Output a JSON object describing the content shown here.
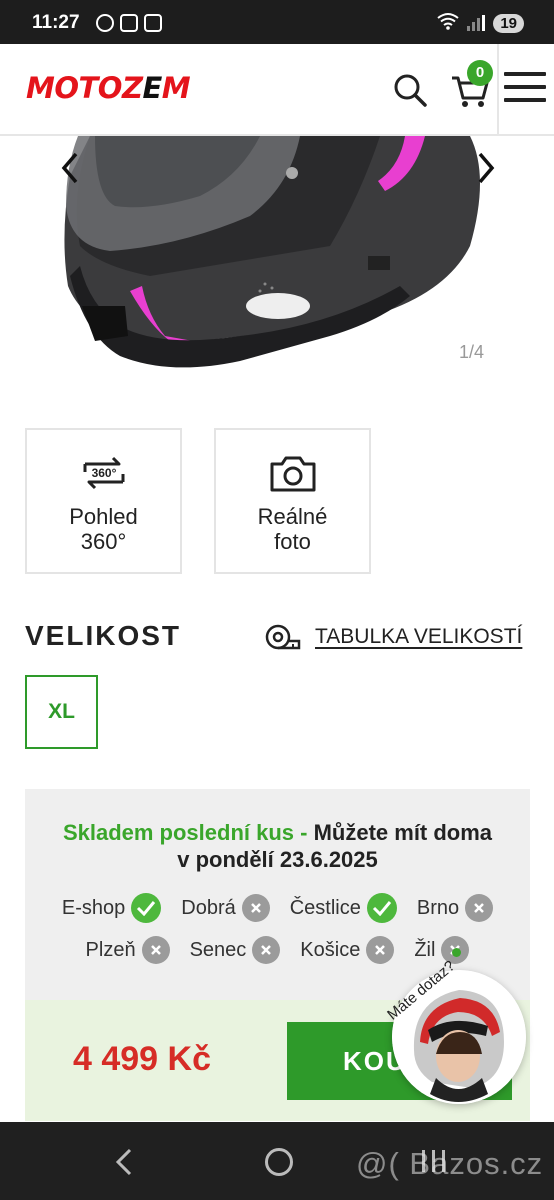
{
  "status_bar": {
    "time": "11:27",
    "battery": "19"
  },
  "header": {
    "logo_main": "MOTOZ",
    "logo_accent": "E",
    "logo_end": "M",
    "cart_count": "0"
  },
  "gallery": {
    "counter": "1/4"
  },
  "features": [
    {
      "icon_label": "360°",
      "label_line1": "Pohled",
      "label_line2": "360°"
    },
    {
      "label_line1": "Reálné",
      "label_line2": "foto"
    }
  ],
  "size": {
    "title": "VELIKOST",
    "table_link": "TABULKA VELIKOSTÍ",
    "options": [
      "XL"
    ]
  },
  "stock": {
    "status": "Skladem poslední kus -",
    "delivery_prefix": "Můžete mít doma",
    "delivery_date": "v pondělí 23.6.2025",
    "stores_row1": [
      {
        "name": "E-shop",
        "available": true
      },
      {
        "name": "Dobrá",
        "available": false
      },
      {
        "name": "Čestlice",
        "available": true
      },
      {
        "name": "Brno",
        "available": false
      }
    ],
    "stores_row2": [
      {
        "name": "Plzeň",
        "available": false
      },
      {
        "name": "Senec",
        "available": false
      },
      {
        "name": "Košice",
        "available": false
      },
      {
        "name": "Žil",
        "available": false
      }
    ]
  },
  "price": {
    "value": "4 499 Kč",
    "buy_label": "KOUPIT"
  },
  "chat": {
    "label": "Máte dotaz?"
  },
  "watermark": "@( Bazos.cz",
  "colors": {
    "brand_red": "#e4141b",
    "green": "#3aa62b",
    "price_red": "#d62c26"
  }
}
